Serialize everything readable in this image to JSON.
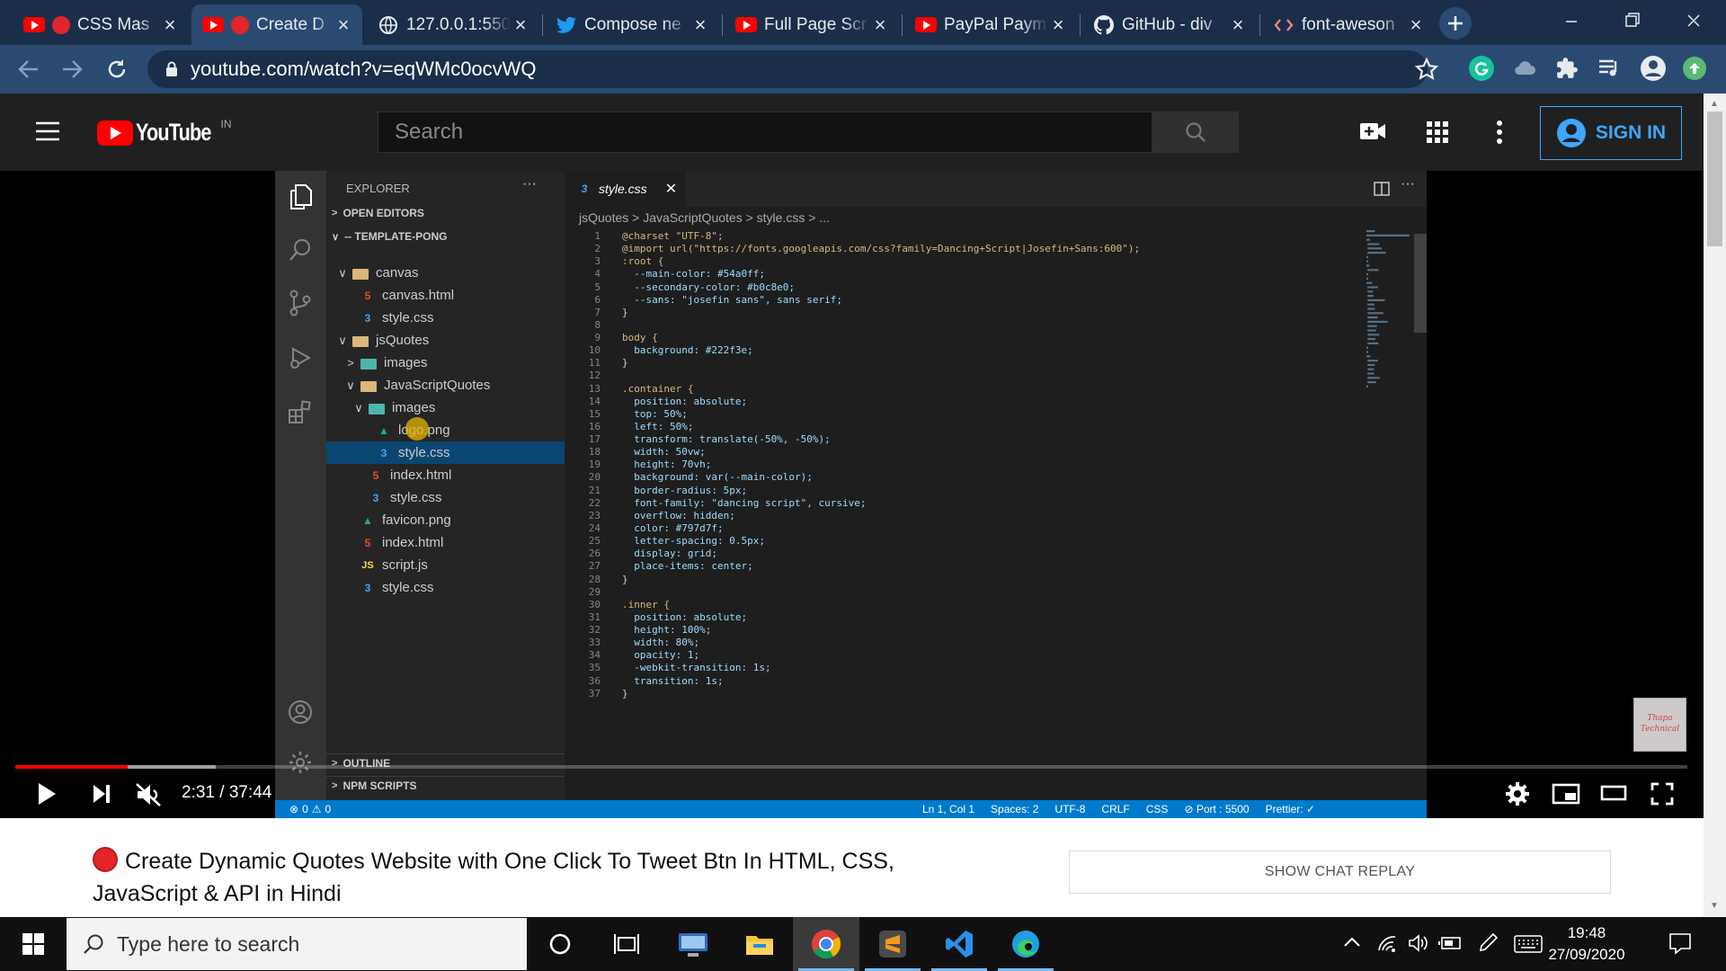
{
  "browser": {
    "tabs": [
      {
        "title": "CSS Mas",
        "icon": "youtube-icon",
        "recording_dot": true
      },
      {
        "title": "Create D",
        "icon": "youtube-icon",
        "recording_dot": true,
        "active": true
      },
      {
        "title": "127.0.0.1:550",
        "icon": "globe-icon"
      },
      {
        "title": "Compose ne",
        "icon": "twitter-icon"
      },
      {
        "title": "Full Page Scr",
        "icon": "youtube-icon"
      },
      {
        "title": "PayPal Paym",
        "icon": "youtube-icon"
      },
      {
        "title": "GitHub - div",
        "icon": "github-icon"
      },
      {
        "title": "font-aweson",
        "icon": "code-icon"
      }
    ],
    "url": "youtube.com/watch?v=eqWMc0ocvWQ"
  },
  "youtube": {
    "logo_text": "YouTube",
    "region": "IN",
    "search_placeholder": "Search",
    "sign_in": "SIGN IN",
    "video_title": "Create Dynamic Quotes Website with One Click To Tweet Btn In HTML, CSS, JavaScript & API in Hindi",
    "show_chat_replay": "SHOW CHAT REPLAY",
    "time_current": "2:31",
    "time_total": "37:44",
    "time_display": "2:31 / 37:44",
    "progress_played_fraction": 0.067,
    "progress_buffered_fraction": 0.12,
    "thumbnail_text": "Thapa Technical"
  },
  "vscode": {
    "explorer_title": "EXPLORER",
    "more": "···",
    "open_editors": "OPEN EDITORS",
    "workspace": "-- TEMPLATE-PONG",
    "tree": [
      {
        "label": "canvas",
        "type": "folder",
        "depth": 1,
        "open": true
      },
      {
        "label": "canvas.html",
        "type": "html",
        "depth": 2
      },
      {
        "label": "style.css",
        "type": "css",
        "depth": 2
      },
      {
        "label": "jsQuotes",
        "type": "folder",
        "depth": 1,
        "open": true
      },
      {
        "label": "images",
        "type": "imgfolder",
        "depth": 2,
        "open": false
      },
      {
        "label": "JavaScriptQuotes",
        "type": "folder",
        "depth": 2,
        "open": true
      },
      {
        "label": "images",
        "type": "imgfolder",
        "depth": 3,
        "open": true
      },
      {
        "label": "logo.png",
        "type": "img",
        "depth": 4
      },
      {
        "label": "style.css",
        "type": "css",
        "depth": 4,
        "selected": true
      },
      {
        "label": "index.html",
        "type": "html",
        "depth": 3
      },
      {
        "label": "style.css",
        "type": "css",
        "depth": 3
      },
      {
        "label": "favicon.png",
        "type": "img",
        "depth": 2
      },
      {
        "label": "index.html",
        "type": "html",
        "depth": 2
      },
      {
        "label": "script.js",
        "type": "js",
        "depth": 2
      },
      {
        "label": "style.css",
        "type": "css",
        "depth": 2
      }
    ],
    "outline": "OUTLINE",
    "npm_scripts": "NPM SCRIPTS",
    "editor_tab": "style.css",
    "breadcrumbs": "jsQuotes > JavaScriptQuotes > style.css > ...",
    "code_lines": [
      "@charset \"UTF-8\";",
      "@import url(\"https://fonts.googleapis.com/css?family=Dancing+Script|Josefin+Sans:600\");",
      ":root {",
      "  --main-color: #54a0ff;",
      "  --secondary-color: #b0c8e0;",
      "  --sans: \"josefin sans\", sans serif;",
      "}",
      "",
      "body {",
      "  background: #222f3e;",
      "}",
      "",
      ".container {",
      "  position: absolute;",
      "  top: 50%;",
      "  left: 50%;",
      "  transform: translate(-50%, -50%);",
      "  width: 50vw;",
      "  height: 70vh;",
      "  background: var(--main-color);",
      "  border-radius: 5px;",
      "  font-family: \"dancing script\", cursive;",
      "  overflow: hidden;",
      "  color: #797d7f;",
      "  letter-spacing: 0.5px;",
      "  display: grid;",
      "  place-items: center;",
      "}",
      "",
      ".inner {",
      "  position: absolute;",
      "  height: 100%;",
      "  width: 80%;",
      "  opacity: 1;",
      "  -webkit-transition: 1s;",
      "  transition: 1s;",
      "}"
    ],
    "status": {
      "errors": "0",
      "warnings": "0",
      "position": "Ln 1, Col 1",
      "spaces": "Spaces: 2",
      "encoding": "UTF-8",
      "eol": "CRLF",
      "language": "CSS",
      "port": "Port : 5500",
      "prettier": "Prettier: ✓"
    }
  },
  "taskbar": {
    "search_placeholder": "Type here to search",
    "time": "19:48",
    "date": "27/09/2020"
  }
}
